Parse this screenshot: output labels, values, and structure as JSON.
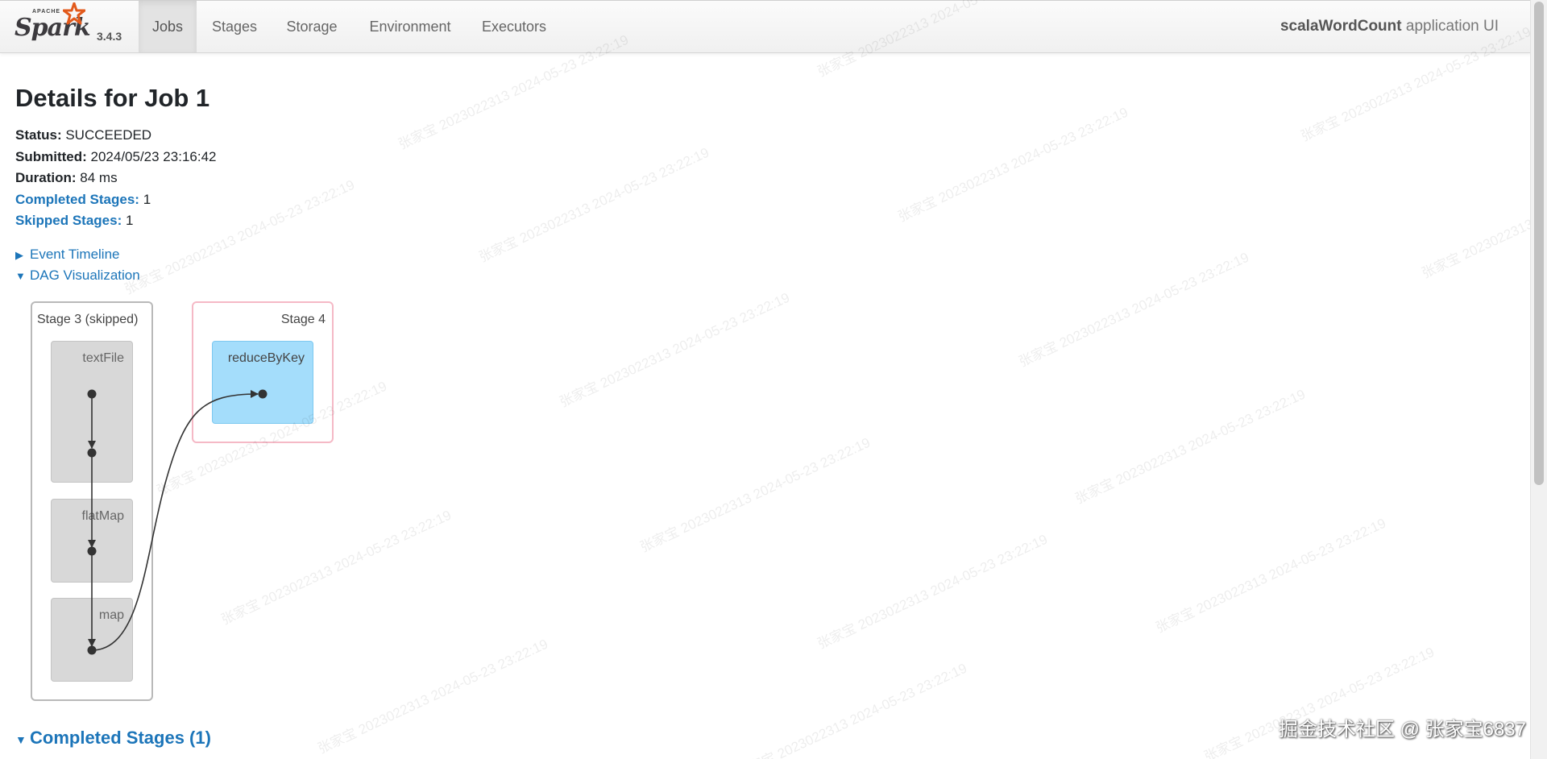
{
  "navbar": {
    "brand_apache": "APACHE",
    "brand_name": "Spark",
    "version": "3.4.3",
    "tabs": [
      {
        "label": "Jobs",
        "active": true
      },
      {
        "label": "Stages",
        "active": false
      },
      {
        "label": "Storage",
        "active": false
      },
      {
        "label": "Environment",
        "active": false
      },
      {
        "label": "Executors",
        "active": false
      }
    ],
    "app_name": "scalaWordCount",
    "app_suffix": " application UI"
  },
  "page": {
    "title": "Details for Job 1",
    "status_label": "Status:",
    "status_value": " SUCCEEDED",
    "submitted_label": "Submitted:",
    "submitted_value": " 2024/05/23 23:16:42",
    "duration_label": "Duration:",
    "duration_value": " 84 ms",
    "completed_stages_label": "Completed Stages:",
    "completed_stages_value": " 1",
    "skipped_stages_label": "Skipped Stages:",
    "skipped_stages_value": " 1"
  },
  "toggles": {
    "event_timeline": "Event Timeline",
    "dag_visualization": "DAG Visualization",
    "completed_stages_header": "Completed Stages (1)"
  },
  "dag": {
    "stage_skipped_label": "Stage 3 (skipped)",
    "stage_active_label": "Stage 4",
    "rdd_textfile": "textFile",
    "rdd_flatmap": "flatMap",
    "rdd_map": "map",
    "rdd_reducebykey": "reduceByKey"
  },
  "watermark": {
    "text": "张家宝 2023022313 2024-05-23 23:22:19",
    "corner": "掘金技术社区 @ 张家宝6837"
  },
  "colors": {
    "link": "#1c75b9",
    "skipped_rdd": "#d8d8d8",
    "active_rdd": "#a4ddfb",
    "active_stage_border": "#f5b9c6"
  }
}
